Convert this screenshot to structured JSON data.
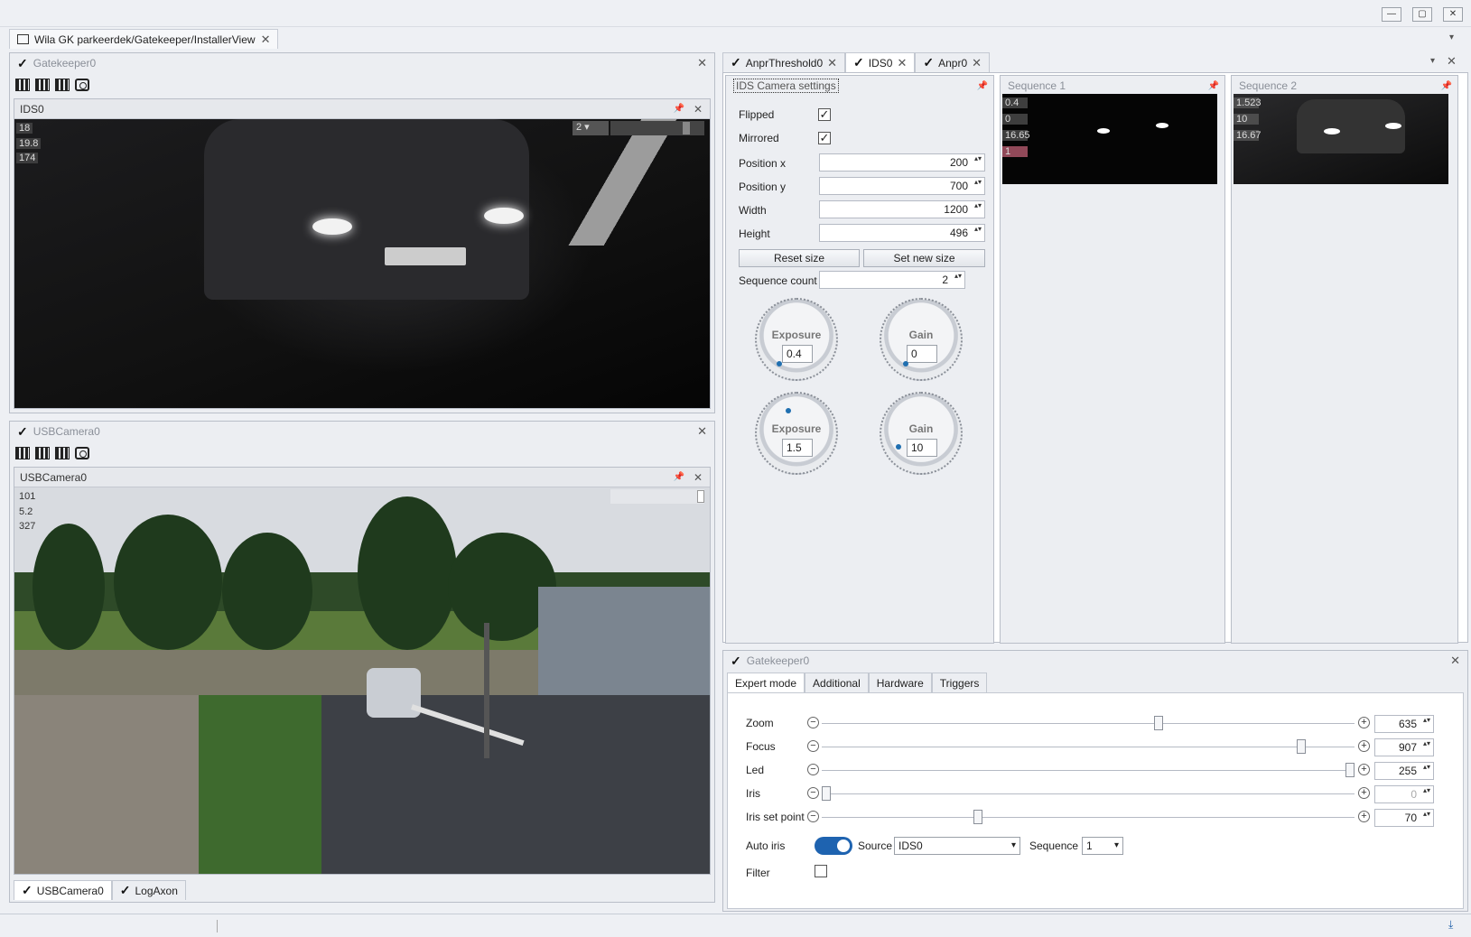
{
  "window": {
    "doc_tab": "Wila GK parkeerdek/Gatekeeper/InstallerView"
  },
  "left_top": {
    "title": "Gatekeeper0",
    "view_title": "IDS0",
    "overlay": [
      "18",
      "19.8",
      "174"
    ],
    "seq_select": "2"
  },
  "left_bottom": {
    "title": "USBCamera0",
    "view_title": "USBCamera0",
    "overlay": [
      "101",
      "5.2",
      "327"
    ],
    "bottom_tabs": [
      "USBCamera0",
      "LogAxon"
    ]
  },
  "right_tabs": [
    "AnprThreshold0",
    "IDS0",
    "Anpr0"
  ],
  "ids_settings": {
    "title": "IDS Camera settings",
    "flipped_label": "Flipped",
    "mirrored_label": "Mirrored",
    "flipped": true,
    "mirrored": true,
    "position_x_label": "Position x",
    "position_x": "200",
    "position_y_label": "Position y",
    "position_y": "700",
    "width_label": "Width",
    "width": "1200",
    "height_label": "Height",
    "height": "496",
    "reset_size": "Reset size",
    "set_new_size": "Set new size",
    "sequence_count_label": "Sequence count",
    "sequence_count": "2",
    "knobs": [
      {
        "label": "Exposure",
        "value": "0.4"
      },
      {
        "label": "Gain",
        "value": "0"
      },
      {
        "label": "Exposure",
        "value": "1.5"
      },
      {
        "label": "Gain",
        "value": "10"
      }
    ]
  },
  "sequence1": {
    "title": "Sequence 1",
    "overlay": [
      "0.4",
      "0",
      "16.65",
      "1"
    ]
  },
  "sequence2": {
    "title": "Sequence 2",
    "overlay": [
      "1.523",
      "10",
      "16.67"
    ]
  },
  "gatekeeper_panel": {
    "title": "Gatekeeper0",
    "tabs": [
      "Expert mode",
      "Additional",
      "Hardware",
      "Triggers"
    ],
    "sliders": [
      {
        "label": "Zoom",
        "value": "635",
        "fraction": 0.635
      },
      {
        "label": "Focus",
        "value": "907",
        "fraction": 0.907
      },
      {
        "label": "Led",
        "value": "255",
        "fraction": 1.0
      },
      {
        "label": "Iris",
        "value": "0",
        "fraction": 0.0
      },
      {
        "label": "Iris set point",
        "value": "70",
        "fraction": 0.29
      }
    ],
    "auto_iris_label": "Auto iris",
    "auto_iris_on": true,
    "source_label": "Source",
    "source_value": "IDS0",
    "sequence_label": "Sequence",
    "sequence_value": "1",
    "filter_label": "Filter"
  }
}
